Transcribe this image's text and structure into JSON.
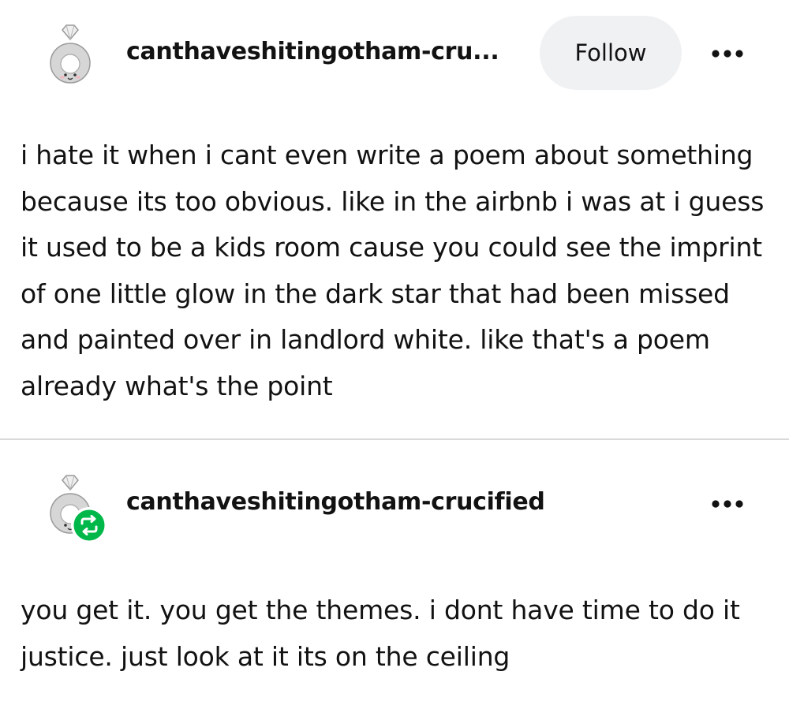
{
  "posts": [
    {
      "username": "canthaveshitingotham-cru...",
      "follow_label": "Follow",
      "more_icon": "more-horizontal-icon",
      "avatar_icon": "ring-plush-avatar",
      "text": "i hate it when i cant even write a poem about something because its too obvious. like in the airbnb i was at i guess it used to be a kids room cause you could see the imprint of one little glow in the dark star that had been missed and painted over in landlord white. like that's a poem already what's the point"
    },
    {
      "username": "canthaveshitingotham-crucified",
      "more_icon": "more-horizontal-icon",
      "avatar_icon": "ring-plush-avatar",
      "badge_icon": "reblog-icon",
      "text": "you get it. you get the themes. i dont have time to do it justice. just look at it its on the ceiling"
    }
  ],
  "colors": {
    "text": "#121212",
    "follow_bg": "#f0f1f3",
    "reblog_green": "#00b84a",
    "divider": "#d9d9d9"
  }
}
